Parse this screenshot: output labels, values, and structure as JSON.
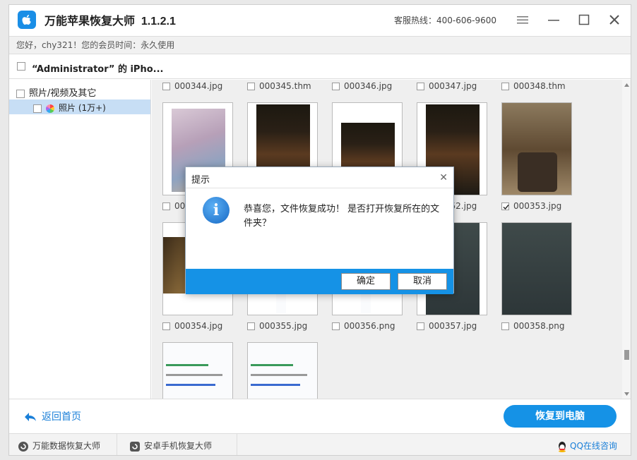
{
  "app": {
    "title": "万能苹果恢复大师",
    "version": "1.1.2.1",
    "hotline": "客服热线：400-606-9600"
  },
  "user": {
    "greeting": "您好，chy321！您的会员时间：永久使用"
  },
  "device": {
    "name": "“Administrator” 的 iPho..."
  },
  "tree": {
    "root": "照片/视频及其它",
    "child": "照片 (1万+)"
  },
  "files": {
    "row0": [
      "000344.jpg",
      "000345.thm",
      "000346.jpg",
      "000347.jpg",
      "000348.thm"
    ],
    "row1": [
      "000349.jpg",
      "",
      "",
      "000352.jpg",
      "000353.jpg"
    ],
    "row2": [
      "000354.jpg",
      "000355.jpg",
      "000356.png",
      "000357.jpg",
      "000358.png"
    ]
  },
  "footer": {
    "back": "返回首页",
    "recover": "恢复到电脑"
  },
  "bottom": {
    "data_recovery": "万能数据恢复大师",
    "android_recovery": "安卓手机恢复大师",
    "qq": "QQ在线咨询"
  },
  "dialog": {
    "title": "提示",
    "message": "恭喜您，文件恢复成功！ 是否打开恢复所在的文件夹？",
    "ok": "确定",
    "cancel": "取消"
  },
  "colors": {
    "accent": "#1592e6",
    "link": "#1a7fd8",
    "selection": "#c7def5"
  }
}
